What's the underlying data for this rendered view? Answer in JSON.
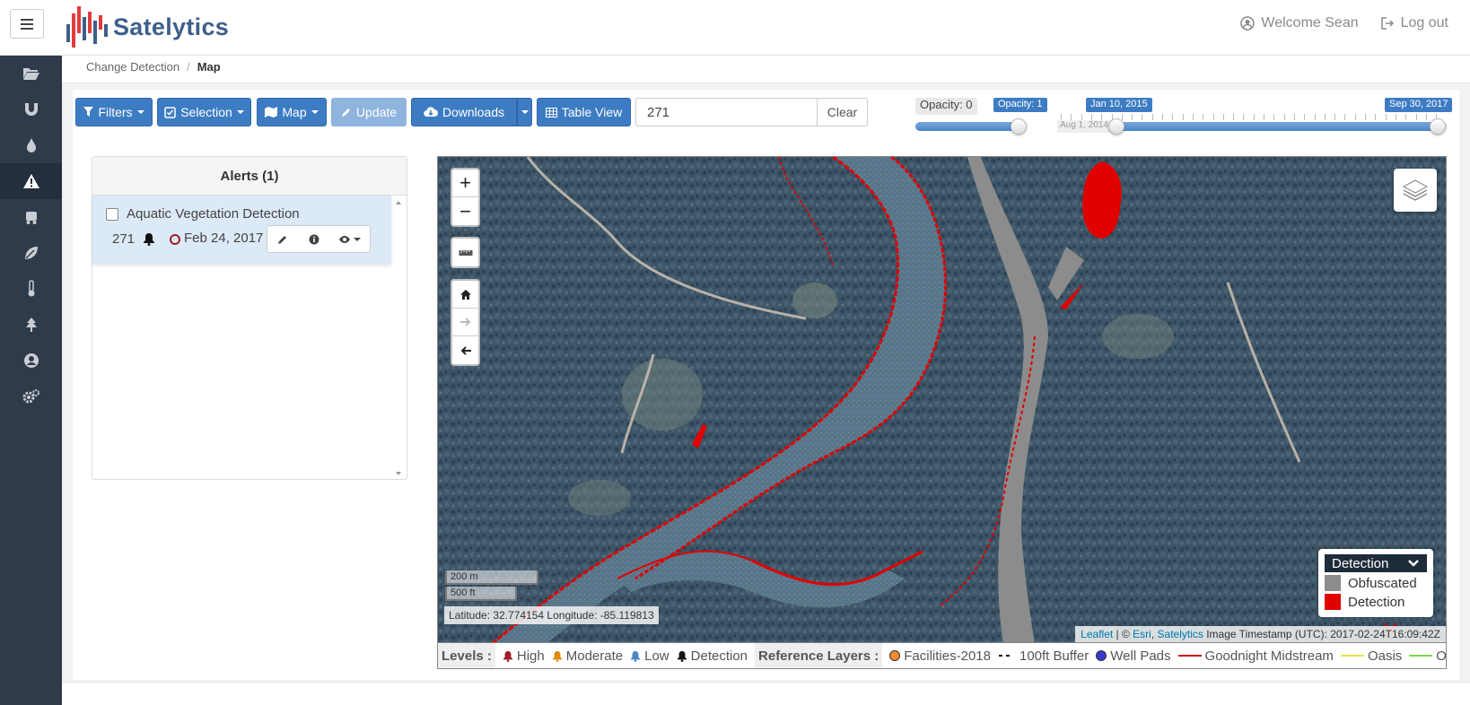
{
  "app": {
    "name": "Satelytics"
  },
  "header": {
    "welcome": "Welcome Sean",
    "logout": "Log out"
  },
  "breadcrumb": {
    "parent": "Change Detection",
    "current": "Map"
  },
  "toolbar": {
    "filters": "Filters",
    "selection": "Selection",
    "map": "Map",
    "update": "Update",
    "downloads": "Downloads",
    "table_view": "Table View",
    "search_value": "271",
    "clear": "Clear"
  },
  "opacity_slider": {
    "label": "Opacity: 0",
    "value_label": "Opacity: 1",
    "value": 1
  },
  "date_slider": {
    "min_label": "Aug 1, 2014",
    "start_label": "Jan 10, 2015",
    "end_label": "Sep 30, 2017"
  },
  "alerts": {
    "title": "Alerts (1)",
    "items": [
      {
        "title": "Aquatic Vegetation Detection",
        "id": "271",
        "date": "Feb 24, 2017"
      }
    ]
  },
  "map": {
    "scale_m": "200 m",
    "scale_ft": "500 ft",
    "coords": "Latitude: 32.774154 Longitude: -85.119813",
    "attribution": {
      "leaflet": "Leaflet",
      "sep1": " | © ",
      "esri": "Esri",
      "sep2": ", ",
      "satelytics": "Satelytics",
      "timestamp": " Image Timestamp (UTC): 2017-02-24T16:09:42Z"
    },
    "legend": {
      "title": "Detection",
      "items": [
        {
          "label": "Obfuscated",
          "color": "#8c8c8c"
        },
        {
          "label": "Detection",
          "color": "#e00000"
        }
      ]
    }
  },
  "legend_bar": {
    "levels_label": "Levels :",
    "levels": [
      {
        "label": "High",
        "color": "#a01c2c"
      },
      {
        "label": "Moderate",
        "color": "#e08a10"
      },
      {
        "label": "Low",
        "color": "#4a86c8"
      },
      {
        "label": "Detection",
        "color": "#111111"
      }
    ],
    "ref_label": "Reference Layers :",
    "refs": [
      {
        "label": "Facilities-2018",
        "color": "#f08a30",
        "kind": "dot"
      },
      {
        "label": "100ft Buffer",
        "color": "#111111",
        "kind": "dash"
      },
      {
        "label": "Well Pads",
        "color": "#3a3ad0",
        "kind": "dot"
      },
      {
        "label": "Goodnight Midstream",
        "color": "#cc1111",
        "kind": "line"
      },
      {
        "label": "Oasis",
        "color": "#e6e64a",
        "kind": "line"
      },
      {
        "label": "ONEOK",
        "color": "#7fd84a",
        "kind": "line"
      }
    ]
  },
  "colors": {
    "accent": "#3d7cc3",
    "sidebar": "#2f3a4b",
    "brand_text": "#3e5f8a"
  }
}
